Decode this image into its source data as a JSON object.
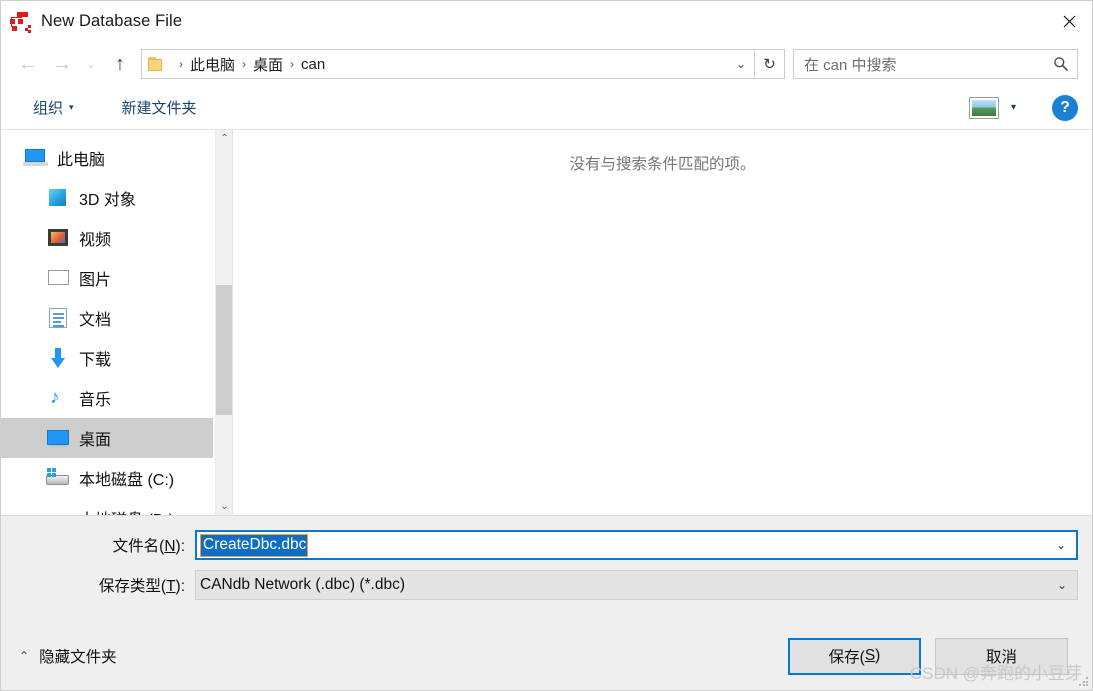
{
  "window": {
    "title": "New Database File",
    "icon": "database-network-icon",
    "close_label": "✕"
  },
  "nav": {
    "back": "←",
    "forward": "→",
    "recent": "⌄",
    "up": "↑",
    "refresh": "↻",
    "dropdown": "⌄",
    "breadcrumbs": [
      "此电脑",
      "桌面",
      "can"
    ],
    "separator": "›"
  },
  "search": {
    "placeholder": "在 can 中搜索",
    "icon": "search-icon"
  },
  "toolbar": {
    "organize": "组织",
    "new_folder": "新建文件夹",
    "caret": "▾",
    "view_caret": "▾",
    "help": "?"
  },
  "sidebar": {
    "items": [
      {
        "label": "此电脑",
        "icon": "computer-icon",
        "indent": false,
        "selected": false
      },
      {
        "label": "3D 对象",
        "icon": "cube-icon",
        "indent": true,
        "selected": false
      },
      {
        "label": "视频",
        "icon": "video-icon",
        "indent": true,
        "selected": false
      },
      {
        "label": "图片",
        "icon": "pictures-icon",
        "indent": true,
        "selected": false
      },
      {
        "label": "文档",
        "icon": "documents-icon",
        "indent": true,
        "selected": false
      },
      {
        "label": "下载",
        "icon": "downloads-icon",
        "indent": true,
        "selected": false
      },
      {
        "label": "音乐",
        "icon": "music-icon",
        "indent": true,
        "selected": false
      },
      {
        "label": "桌面",
        "icon": "desktop-icon",
        "indent": true,
        "selected": true
      },
      {
        "label": "本地磁盘 (C:)",
        "icon": "local-disk-c-icon",
        "indent": true,
        "selected": false
      },
      {
        "label": "本地磁盘 (D:)",
        "icon": "local-disk-d-icon",
        "indent": true,
        "selected": false
      }
    ],
    "scroll_up": "⌃",
    "scroll_down": "⌄"
  },
  "filelist": {
    "empty_message": "没有与搜索条件匹配的项。"
  },
  "form": {
    "filename_label_pre": "文件名(",
    "filename_label_key": "N",
    "filename_label_post": "):",
    "filename_value": "CreateDbc.dbc",
    "filetype_label_pre": "保存类型(",
    "filetype_label_key": "T",
    "filetype_label_post": "):",
    "filetype_value": "CANdb Network (.dbc) (*.dbc)",
    "caret": "⌄"
  },
  "footer": {
    "hide_folders": "隐藏文件夹",
    "hide_chevron": "⌃",
    "save_pre": "保存(",
    "save_key": "S",
    "save_post": ")",
    "cancel": "取消",
    "watermark": "CSDN @奔跑的小豆芽"
  },
  "colors": {
    "accent": "#0b78d0",
    "selection": "#0d6ec4",
    "selection_border": "#e8a33d",
    "toolbar_text": "#19456b",
    "panel_bg": "#efefef"
  }
}
